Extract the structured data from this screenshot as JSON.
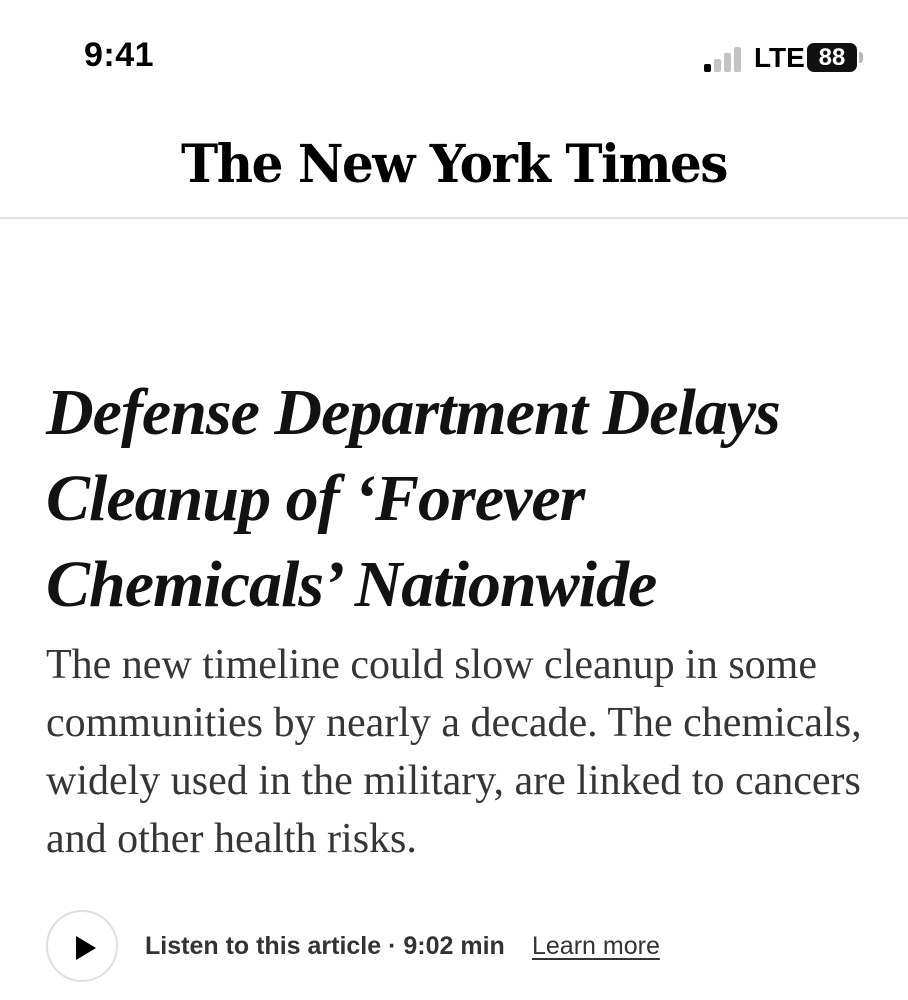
{
  "status_bar": {
    "time": "9:41",
    "network": "LTE",
    "battery": "88",
    "signal_bars_active": 1,
    "signal_bars_total": 4
  },
  "masthead": {
    "logo_text": "The New York Times"
  },
  "article": {
    "headline": "Defense Department Delays Cleanup of ‘Forever Chemicals’ Nationwide",
    "summary": "The new timeline could slow cleanup in some communities by nearly a decade. The chemicals, widely used in the military, are linked to cancers and other health risks."
  },
  "listen": {
    "play_icon": "play-icon",
    "label": "Listen to this article · 9:02 min",
    "learn_more": "Learn more"
  },
  "colors": {
    "text_primary": "#121212",
    "text_secondary": "#363636",
    "divider": "#e2e2e2",
    "signal_active": "#000000",
    "signal_inactive": "#c4c4c4"
  }
}
